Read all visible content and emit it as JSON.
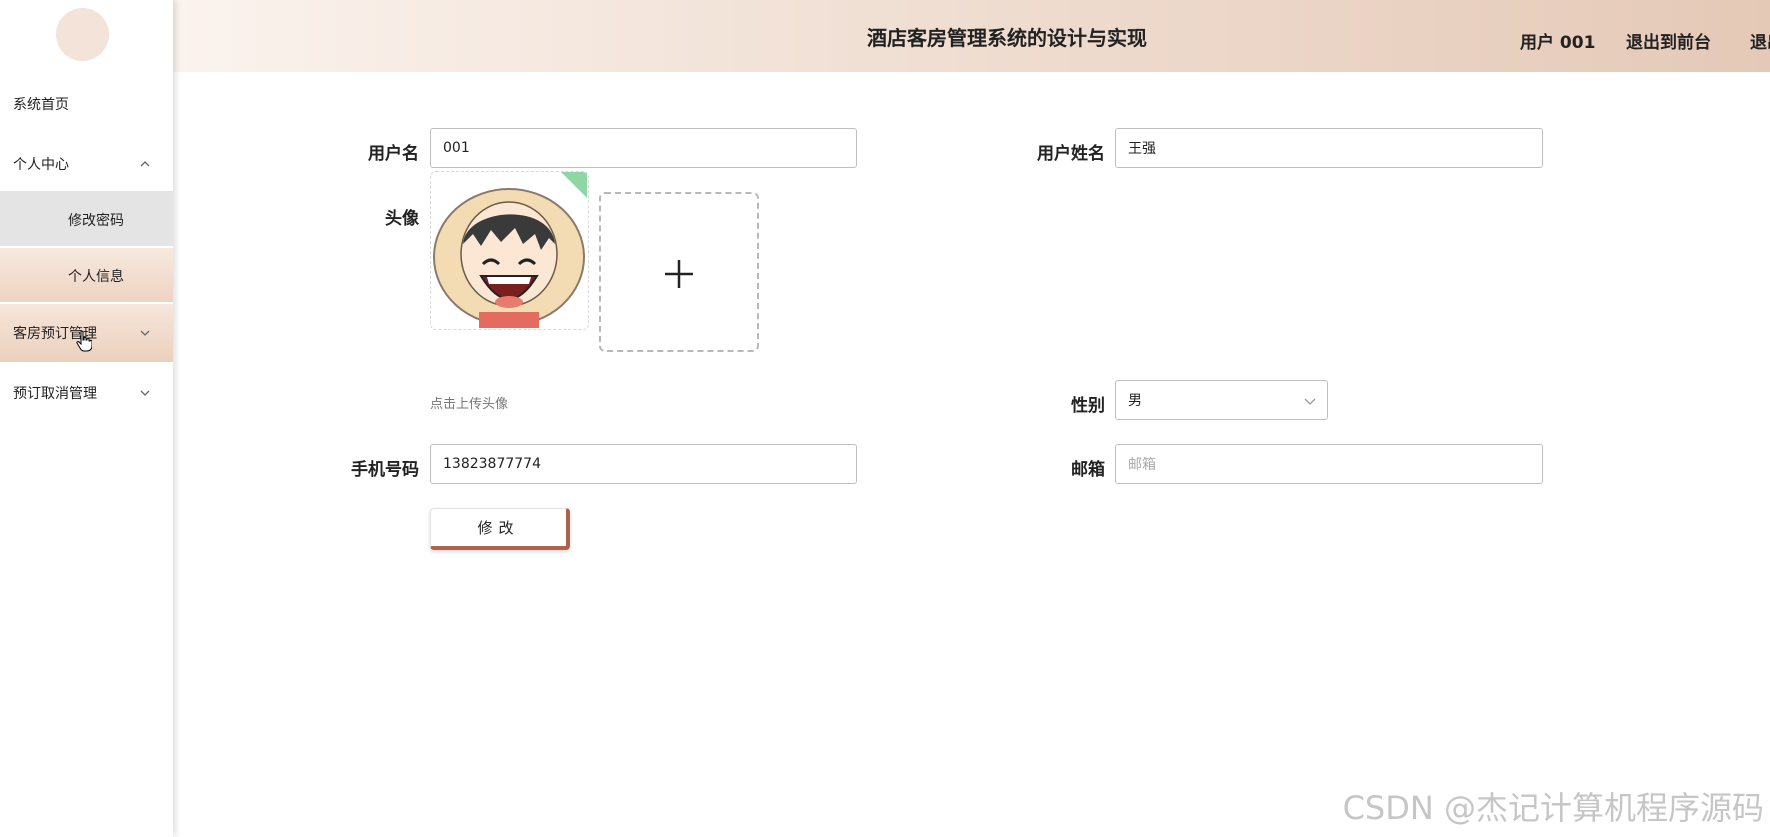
{
  "app_title": "酒店客房管理系统的设计与实现",
  "header": {
    "user": "用户 001",
    "exit_front": "退出到前台",
    "exit_cut": "退出"
  },
  "sidebar": {
    "items": [
      {
        "label": "系统首页"
      },
      {
        "label": "个人中心",
        "expanded": true
      },
      {
        "label": "修改密码"
      },
      {
        "label": "个人信息",
        "active": true
      },
      {
        "label": "客房预订管理"
      },
      {
        "label": "预订取消管理"
      }
    ]
  },
  "form": {
    "username_label": "用户名",
    "username_value": "001",
    "fullname_label": "用户姓名",
    "fullname_value": "王强",
    "avatar_label": "头像",
    "upload_hint": "点击上传头像",
    "gender_label": "性别",
    "gender_value": "男",
    "phone_label": "手机号码",
    "phone_value": "13823877774",
    "email_label": "邮箱",
    "email_placeholder": "邮箱",
    "submit_label": "修改"
  },
  "watermark": "CSDN @杰记计算机程序源码",
  "colors": {
    "header_gradient_start": "#fbf3ee",
    "header_gradient_end": "#e5c9b7",
    "active_menu": "#eed3c1",
    "button_accent": "#b0614e"
  }
}
